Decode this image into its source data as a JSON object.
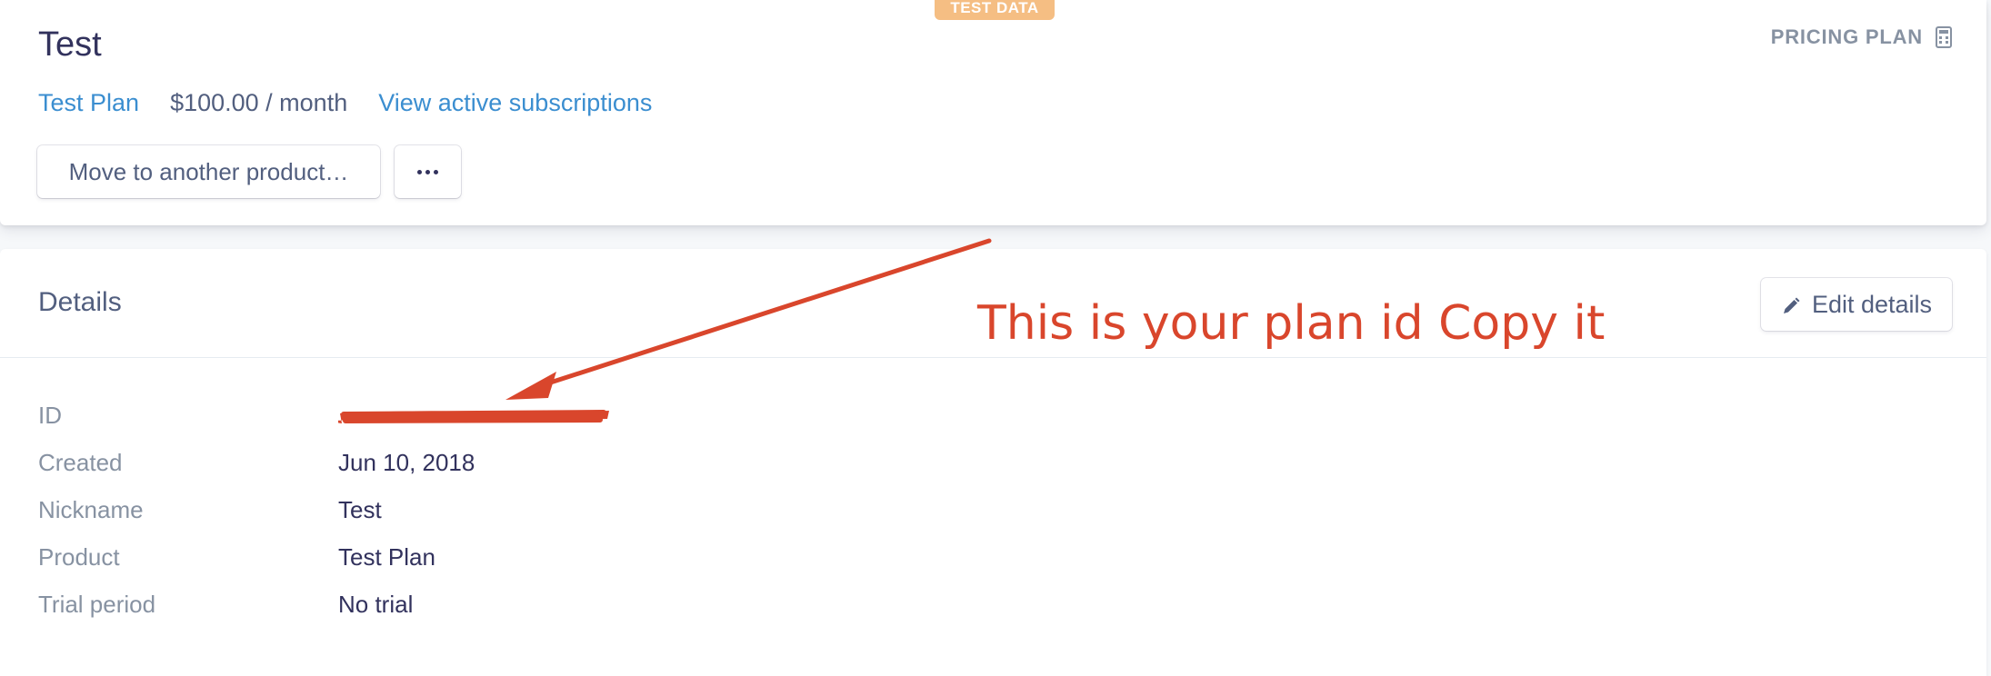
{
  "header": {
    "badge": "TEST DATA",
    "title": "Test",
    "section_label": "PRICING PLAN",
    "section_icon": "calculator-icon",
    "plan_link": "Test Plan",
    "price": "$100.00 / month",
    "subscriptions_link": "View active subscriptions",
    "move_button": "Move to another product…",
    "more_icon": "more-dots-icon"
  },
  "details": {
    "title": "Details",
    "edit_button": "Edit details",
    "edit_icon": "pencil-icon",
    "rows": [
      {
        "label": "ID",
        "value": ""
      },
      {
        "label": "Created",
        "value": "Jun 10, 2018"
      },
      {
        "label": "Nickname",
        "value": "Test"
      },
      {
        "label": "Product",
        "value": "Test Plan"
      },
      {
        "label": "Trial period",
        "value": "No trial"
      }
    ]
  },
  "annotation": {
    "text": "This is your plan id Copy it",
    "color": "#d9462c"
  },
  "colors": {
    "badge": "#f5be83",
    "link": "#3b8ed0",
    "text": "#32325d",
    "muted": "#8792a2"
  }
}
